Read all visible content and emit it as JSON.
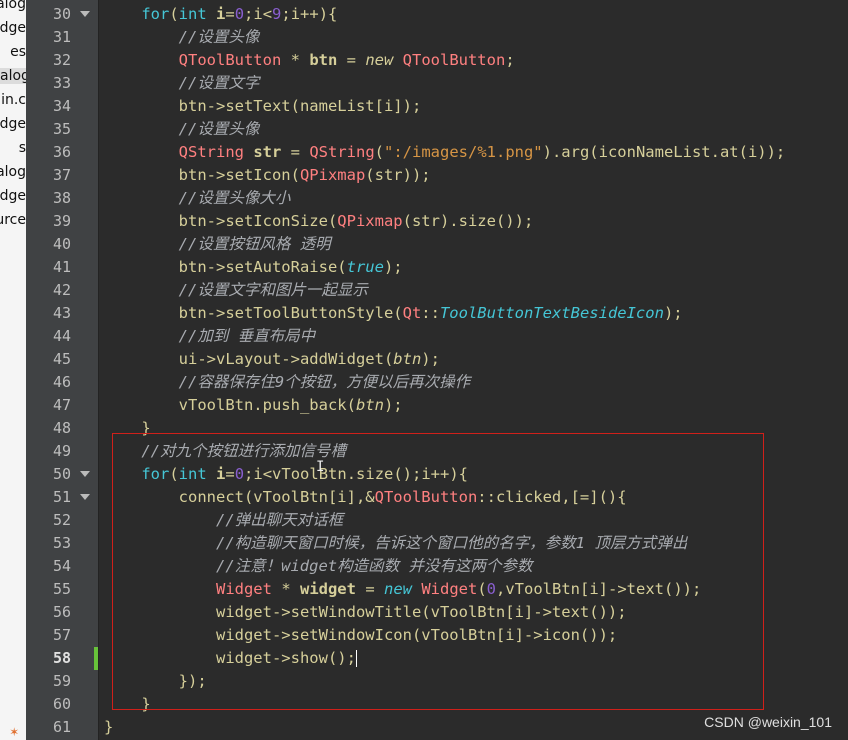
{
  "sidebar": {
    "items": [
      "alog",
      "dge",
      "es",
      "alog",
      "ain.c",
      "dge",
      "s",
      "alog",
      "dge",
      "urce"
    ]
  },
  "editor": {
    "lines": [
      {
        "num": "30",
        "html": "    <span class=\"kw\">for</span>(<span class=\"kw\">int</span> <span class=\"b\">i</span>=<span class=\"num\">0</span>;i&lt;<span class=\"num\">9</span>;i++){"
      },
      {
        "num": "31",
        "html": "        <span class=\"cm\">//设置头像</span>"
      },
      {
        "num": "32",
        "html": "        <span class=\"ty\">QToolButton</span> * <span class=\"b\">btn</span> = <span class=\"it\">new</span> <span class=\"ty\">QToolButton</span>;"
      },
      {
        "num": "33",
        "html": "        <span class=\"cm\">//设置文字</span>"
      },
      {
        "num": "34",
        "html": "        btn-&gt;setText(nameList[i]);"
      },
      {
        "num": "35",
        "html": "        <span class=\"cm\">//设置头像</span>"
      },
      {
        "num": "36",
        "html": "        <span class=\"ty\">QString</span> <span class=\"b\">str</span> = <span class=\"ty\">QString</span>(<span class=\"str\">\":/images/%1.png\"</span>).arg(iconNameList.at(i));"
      },
      {
        "num": "37",
        "html": "        btn-&gt;setIcon(<span class=\"ty\">QPixmap</span>(str));"
      },
      {
        "num": "38",
        "html": "        <span class=\"cm\">//设置头像大小</span>"
      },
      {
        "num": "39",
        "html": "        btn-&gt;setIconSize(<span class=\"ty\">QPixmap</span>(str).size());"
      },
      {
        "num": "40",
        "html": "        <span class=\"cm\">//设置按钮风格 透明</span>"
      },
      {
        "num": "41",
        "html": "        btn-&gt;setAutoRaise(<span class=\"lit\">true</span>);"
      },
      {
        "num": "42",
        "html": "        <span class=\"cm\">//设置文字和图片一起显示</span>"
      },
      {
        "num": "43",
        "html": "        btn-&gt;setToolButtonStyle(<span class=\"ty\">Qt</span>::<span class=\"lit\">ToolButtonTextBesideIcon</span>);"
      },
      {
        "num": "44",
        "html": "        <span class=\"cm\">//加到 垂直布局中</span>"
      },
      {
        "num": "45",
        "html": "        ui-&gt;vLayout-&gt;addWidget(<span class=\"it\">btn</span>);"
      },
      {
        "num": "46",
        "html": "        <span class=\"cm\">//容器保存住9个按钮，方便以后再次操作</span>"
      },
      {
        "num": "47",
        "html": "        vToolBtn.push_back(<span class=\"it\">btn</span>);"
      },
      {
        "num": "48",
        "html": "    }"
      },
      {
        "num": "49",
        "html": "    <span class=\"cm\">//对九个按钮进行添加信号槽</span>"
      },
      {
        "num": "50",
        "html": "    <span class=\"kw\">for</span>(<span class=\"kw\">int</span> <span class=\"b\">i</span>=<span class=\"num\">0</span>;i&lt;vToolBtn.size();i++){"
      },
      {
        "num": "51",
        "html": "        connect(vToolBtn[i],&amp;<span class=\"ty\">QToolButton</span>::clicked,[=](){"
      },
      {
        "num": "52",
        "html": "            <span class=\"cm\">//弹出聊天对话框</span>"
      },
      {
        "num": "53",
        "html": "            <span class=\"cm\">//构造聊天窗口时候，告诉这个窗口他的名字，参数1 顶层方式弹出</span>"
      },
      {
        "num": "54",
        "html": "            <span class=\"cm\">//注意！widget构造函数 并没有这两个参数</span>"
      },
      {
        "num": "55",
        "html": "            <span class=\"ty\">Widget</span> * <span class=\"b\">widget</span> = <span class=\"kw it\">new</span> <span class=\"ty\">Widget</span>(<span class=\"num\">0</span>,vToolBtn[i]-&gt;text());"
      },
      {
        "num": "56",
        "html": "            widget-&gt;setWindowTitle(vToolBtn[i]-&gt;text());"
      },
      {
        "num": "57",
        "html": "            widget-&gt;setWindowIcon(vToolBtn[i]-&gt;icon());"
      },
      {
        "num": "58",
        "html": "            widget-&gt;show();<span class=\"cursor\"></span>"
      },
      {
        "num": "59",
        "html": "        });"
      },
      {
        "num": "60",
        "html": "    }"
      },
      {
        "num": "61",
        "html": "}"
      }
    ],
    "fold_lines": [
      "30",
      "50",
      "51"
    ],
    "modified_line": "58",
    "current_line": "58"
  },
  "watermark": "CSDN @weixin_101"
}
